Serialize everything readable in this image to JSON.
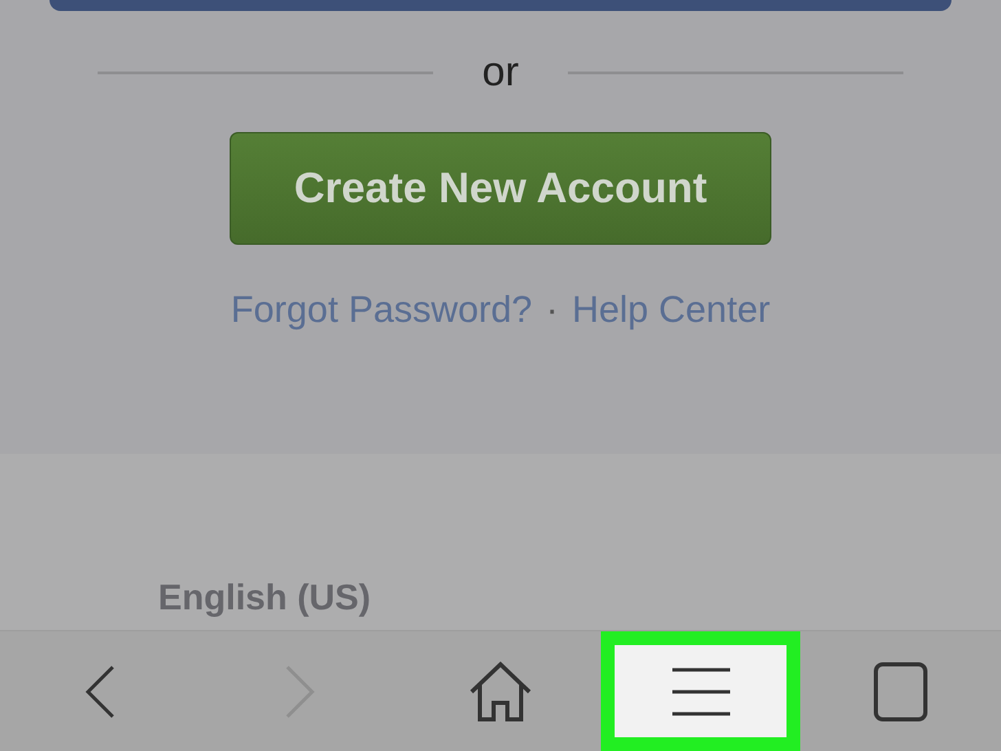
{
  "divider_text": "or",
  "create_button": {
    "label": "Create New Account"
  },
  "links": [
    {
      "label": "Forgot Password?"
    },
    {
      "label": "Help Center"
    }
  ],
  "link_separator": "·",
  "language": "English (US)",
  "toolbar": [
    {
      "kind": "back",
      "disabled": false,
      "highlighted": false
    },
    {
      "kind": "forward",
      "disabled": true,
      "highlighted": false
    },
    {
      "kind": "home",
      "disabled": false,
      "highlighted": false
    },
    {
      "kind": "menu",
      "disabled": false,
      "highlighted": true
    },
    {
      "kind": "tabs",
      "disabled": false,
      "highlighted": false
    }
  ]
}
